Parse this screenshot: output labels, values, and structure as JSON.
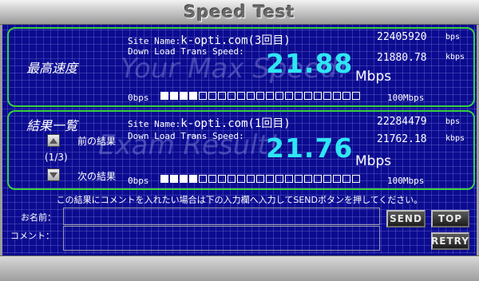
{
  "title": "Speed Test",
  "max_panel": {
    "heading": "最高速度",
    "ghost_text": "Your Max Speed!",
    "site_label": "Site Name:",
    "site_name": "k-opti.com(3回目)",
    "trans_label": "Down Load Trans Speed:",
    "speed": "21.88",
    "unit": "Mbps",
    "bps_value": "22405920",
    "bps_unit": "bps",
    "kbps_value": "21880.78",
    "kbps_unit": "kbps",
    "scale_min": "0bps",
    "scale_max": "100Mbps",
    "bar_filled": 4,
    "bar_total": 21
  },
  "result_panel": {
    "heading": "結果一覧",
    "ghost_text": "Exam Result!",
    "prev_label": "前の結果",
    "page_indicator": "(1/3)",
    "next_label": "次の結果",
    "site_label": "Site Name:",
    "site_name": "k-opti.com(1回目)",
    "trans_label": "Down Load Trans Speed:",
    "speed": "21.76",
    "unit": "Mbps",
    "bps_value": "22284479",
    "bps_unit": "bps",
    "kbps_value": "21762.18",
    "kbps_unit": "kbps",
    "scale_min": "0bps",
    "scale_max": "100Mbps",
    "bar_filled": 4,
    "bar_total": 21
  },
  "comment_form": {
    "instruction": "この結果にコメントを入れたい場合は下の入力欄へ入力してSENDボタンを押してください。",
    "name_label": "お名前：",
    "name_value": "",
    "comment_label": "コメント：",
    "comment_value": "",
    "send_label": "SEND",
    "top_label": "TOP",
    "retry_label": "RETRY"
  }
}
